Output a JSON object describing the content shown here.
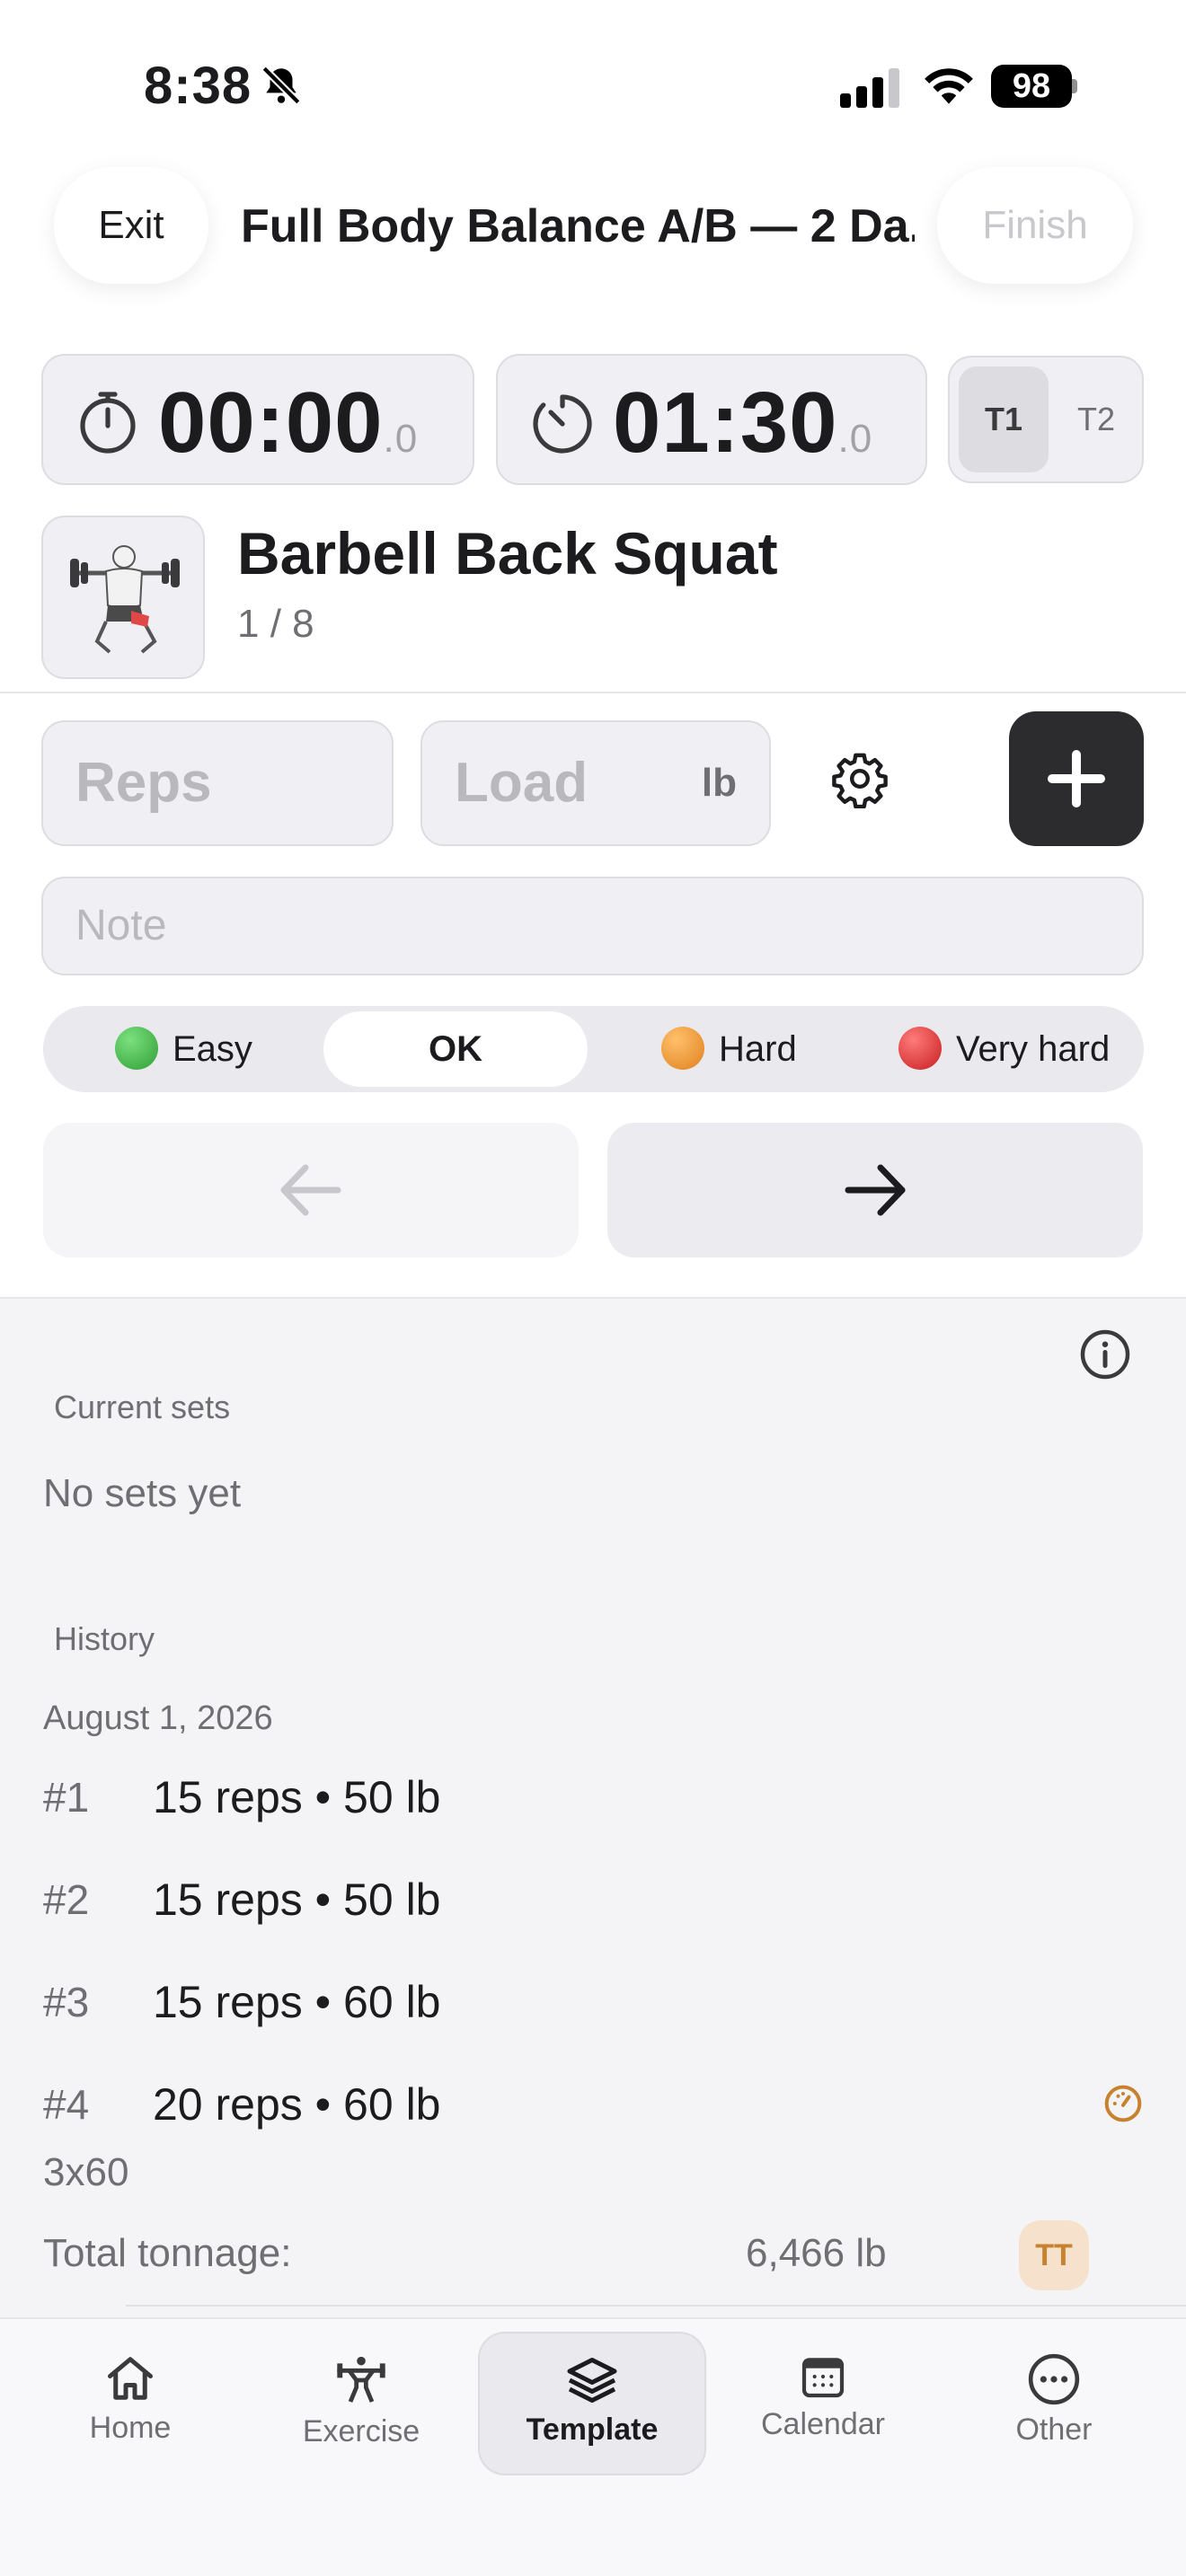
{
  "status_bar": {
    "time": "8:38",
    "battery": "98"
  },
  "header": {
    "exit_label": "Exit",
    "title": "Full Body Balance A/B — 2 Da...",
    "finish_label": "Finish"
  },
  "timers": {
    "elapsed": {
      "main": "00:00",
      "fraction": ".0"
    },
    "rest": {
      "main": "01:30",
      "fraction": ".0"
    },
    "toggle": {
      "t1": "T1",
      "t2": "T2",
      "selected": "T1"
    }
  },
  "exercise": {
    "name": "Barbell Back Squat",
    "progress": "1 / 8"
  },
  "inputs": {
    "reps_placeholder": "Reps",
    "load_placeholder": "Load",
    "load_unit": "lb",
    "note_placeholder": "Note"
  },
  "effort": {
    "options": [
      {
        "label": "Easy",
        "color": "#34a83a"
      },
      {
        "label": "OK",
        "color": ""
      },
      {
        "label": "Hard",
        "color": "#e8892b"
      },
      {
        "label": "Very hard",
        "color": "#d62d2d"
      }
    ],
    "selected": "OK"
  },
  "current_sets": {
    "label": "Current sets",
    "empty_text": "No sets yet"
  },
  "history": {
    "label": "History",
    "date": "August 1, 2026",
    "rows": [
      {
        "num": "#1",
        "value": "15 reps • 50 lb"
      },
      {
        "num": "#2",
        "value": "15 reps • 50 lb"
      },
      {
        "num": "#3",
        "value": "15 reps • 60 lb"
      },
      {
        "num": "#4",
        "value": "20 reps • 60 lb"
      }
    ],
    "summary": "3x60",
    "total_label": "Total tonnage:",
    "total_value": "6,466 lb",
    "badge": "TT"
  },
  "tabs": [
    {
      "label": "Home",
      "icon": "home-icon"
    },
    {
      "label": "Exercise",
      "icon": "weightlifter-icon"
    },
    {
      "label": "Template",
      "icon": "layers-icon",
      "active": true
    },
    {
      "label": "Calendar",
      "icon": "calendar-icon"
    },
    {
      "label": "Other",
      "icon": "ellipsis-icon"
    }
  ],
  "colors": {
    "accent_dark": "#2c2c2e",
    "badge_orange": "#c7822f"
  }
}
